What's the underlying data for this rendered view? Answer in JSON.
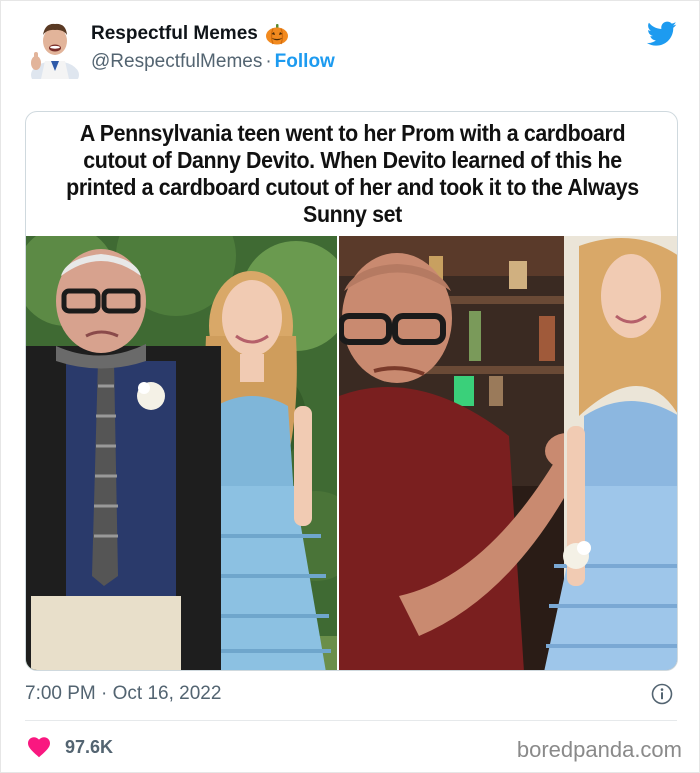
{
  "tweet": {
    "display_name": "Respectful Memes",
    "name_emoji": "pumpkin-icon",
    "handle": "@RespectfulMemes",
    "separator": "·",
    "follow_label": "Follow",
    "timestamp": "7:00 PM · Oct 16, 2022",
    "like_count": "97.6K"
  },
  "media": {
    "caption": "A Pennsylvania teen went to her Prom with a cardboard cutout of Danny Devito. When Devito learned of this he printed a cardboard cutout of her and took it to the Always Sunny set",
    "left_photo": "photo-prom-cutout",
    "right_photo": "photo-devito-with-cutout"
  },
  "site": {
    "watermark": "boredpanda.com"
  },
  "colors": {
    "accent": "#1d9bf0",
    "heart": "#f91880",
    "muted": "#536471"
  }
}
